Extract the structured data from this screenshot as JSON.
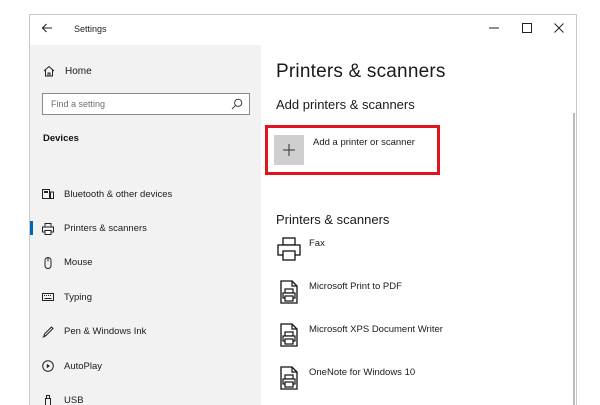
{
  "window": {
    "title": "Settings",
    "back_icon": "arrow-left-icon",
    "controls": [
      "minimize-icon",
      "maximize-icon",
      "close-icon"
    ]
  },
  "sidebar": {
    "home_label": "Home",
    "search": {
      "placeholder": "Find a setting",
      "value": ""
    },
    "section_heading": "Devices",
    "items": [
      {
        "label": "Bluetooth & other devices",
        "icon": "bluetooth-devices-icon",
        "active": false
      },
      {
        "label": "Printers & scanners",
        "icon": "printer-icon",
        "active": true
      },
      {
        "label": "Mouse",
        "icon": "mouse-icon",
        "active": false
      },
      {
        "label": "Typing",
        "icon": "keyboard-icon",
        "active": false
      },
      {
        "label": "Pen & Windows Ink",
        "icon": "pen-icon",
        "active": false
      },
      {
        "label": "AutoPlay",
        "icon": "autoplay-icon",
        "active": false
      },
      {
        "label": "USB",
        "icon": "usb-icon",
        "active": false
      }
    ]
  },
  "main": {
    "title": "Printers & scanners",
    "add_section_title": "Add printers & scanners",
    "add_button_label": "Add a printer or scanner",
    "list_title": "Printers & scanners",
    "printers": [
      {
        "name": "Fax",
        "icon": "fax-printer-icon"
      },
      {
        "name": "Microsoft Print to PDF",
        "icon": "document-printer-icon"
      },
      {
        "name": "Microsoft XPS Document Writer",
        "icon": "document-printer-icon"
      },
      {
        "name": "OneNote for Windows 10",
        "icon": "document-printer-icon"
      }
    ]
  },
  "colors": {
    "highlight_box": "#e0131f",
    "accent": "#0066b4",
    "sidebar_bg": "#f2f2f2"
  }
}
